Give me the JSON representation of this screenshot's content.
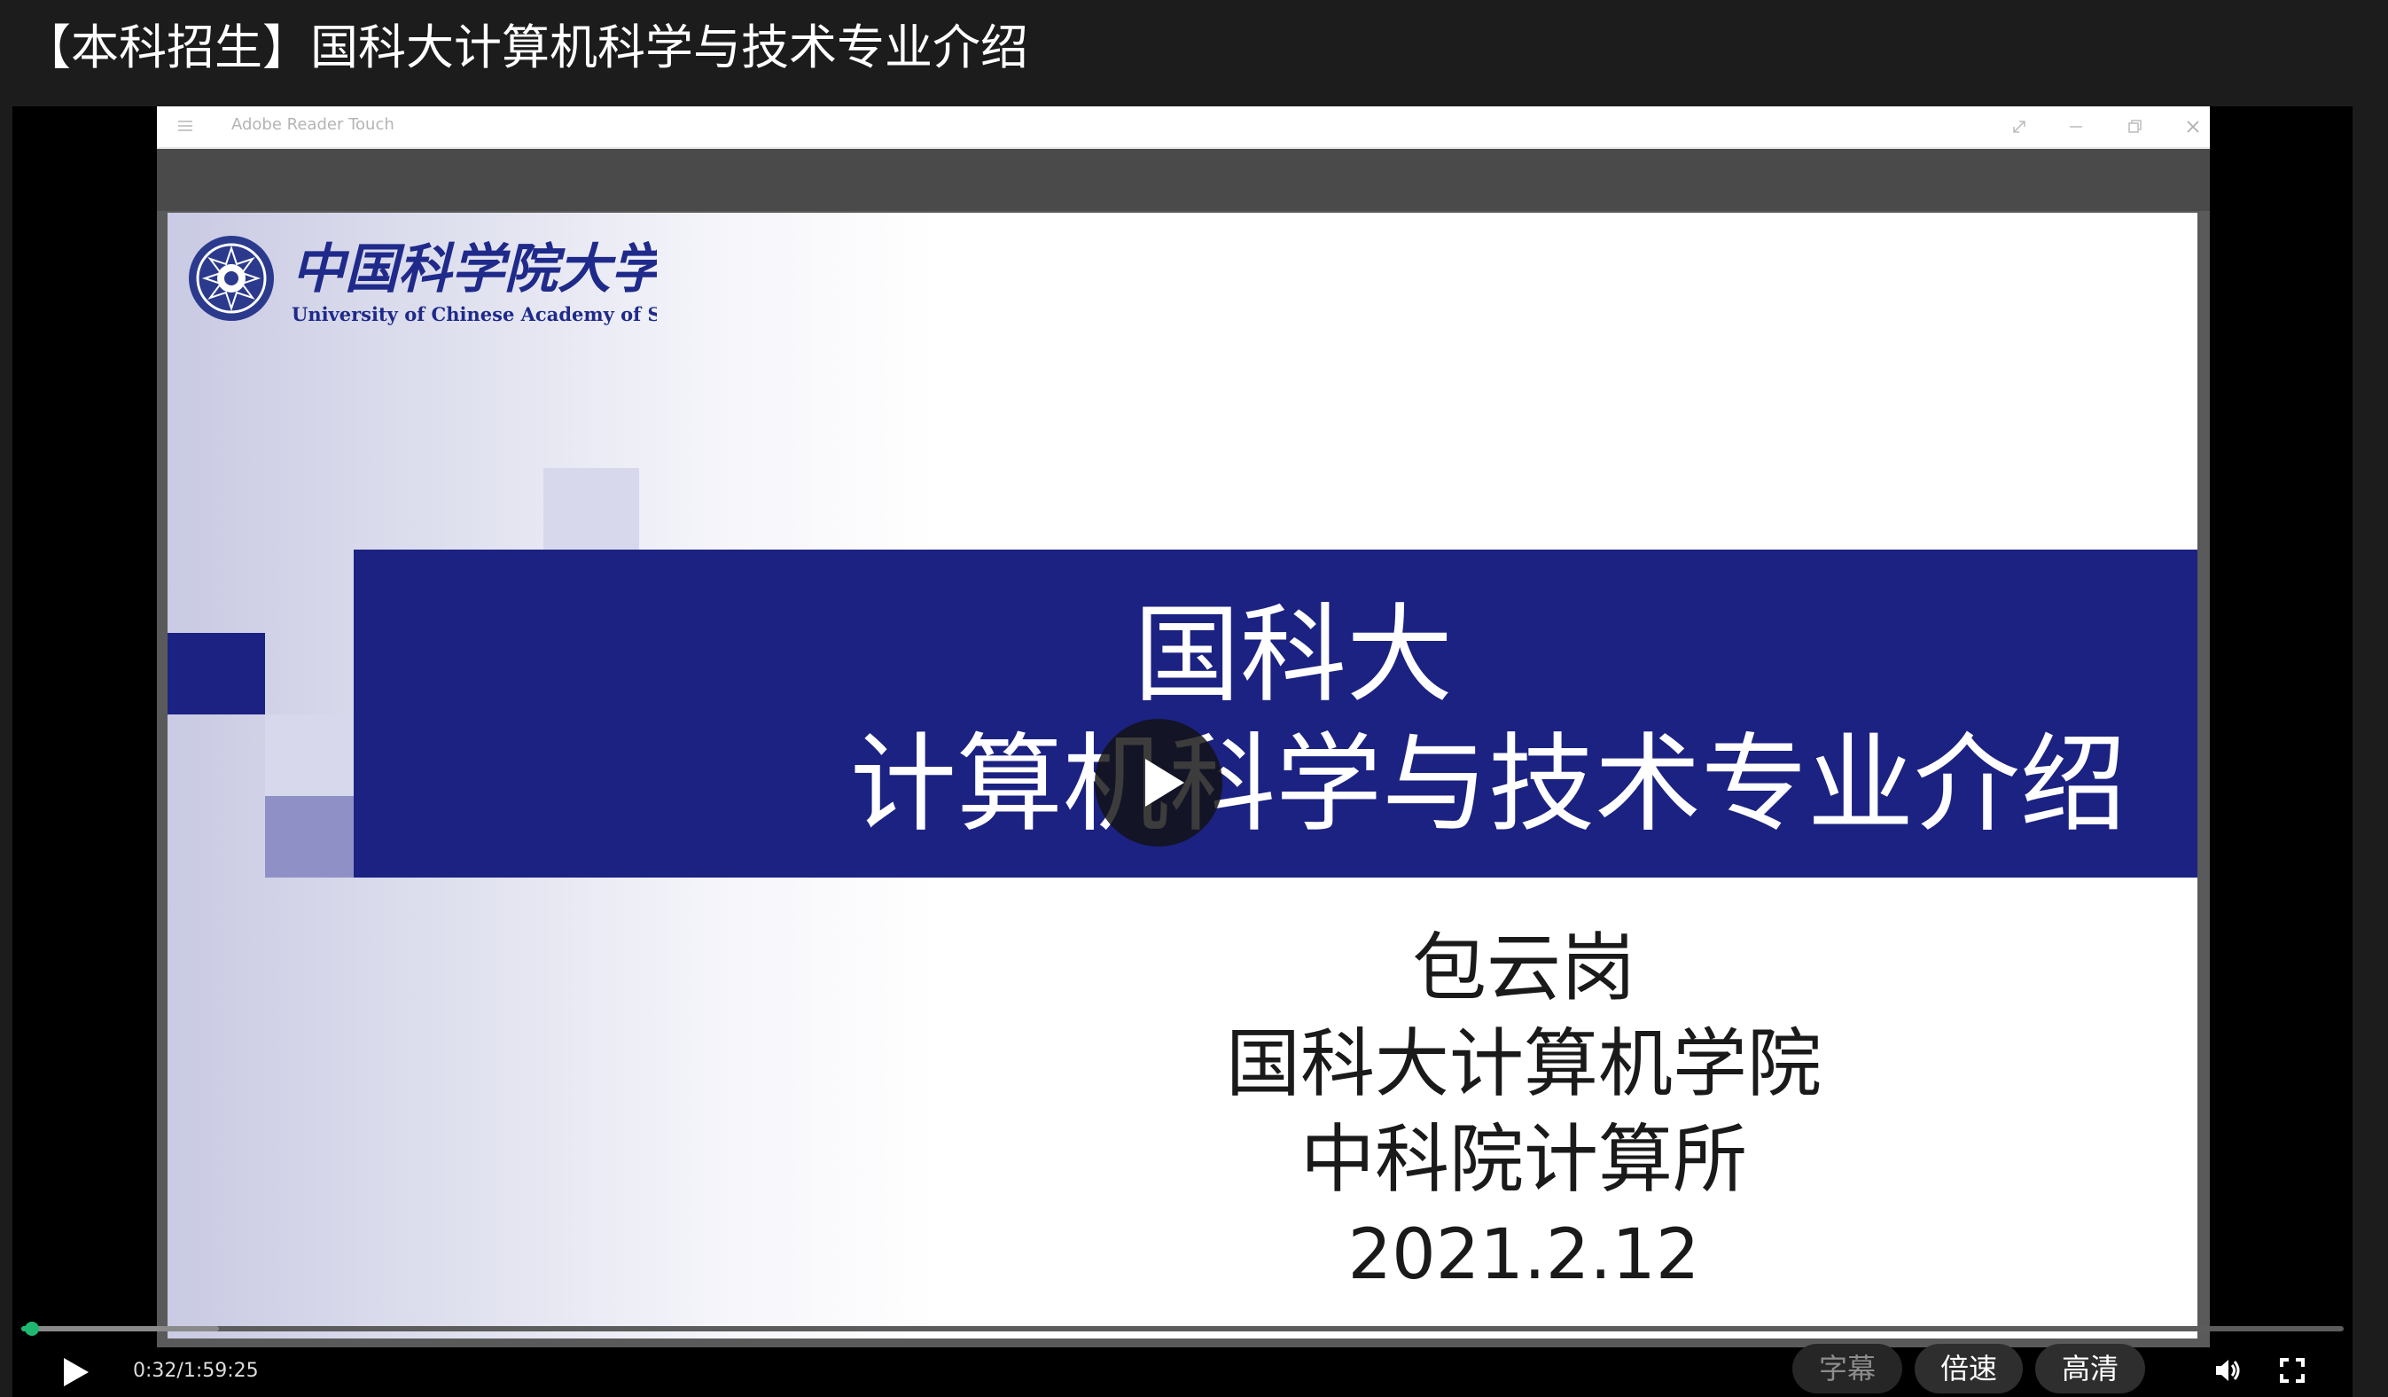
{
  "page": {
    "title": "【本科招生】国科大计算机科学与技术专业介绍"
  },
  "reader_window": {
    "title": "Adobe Reader Touch",
    "icons": [
      "menu-icon",
      "fullscreen-icon",
      "minimize-icon",
      "restore-icon",
      "close-icon"
    ]
  },
  "slide": {
    "logo_text_cn": "中国科学院大学",
    "logo_text_en": "University of Chinese Academy of Sciences",
    "title_line1": "国科大",
    "title_line2": "计算机科学与技术专业介绍",
    "presenter": "包云岗",
    "affiliation1": "国科大计算机学院",
    "affiliation2": "中科院计算所",
    "date": "2021.2.12",
    "colors": {
      "band": "#1c2282",
      "squares_dark": "#8f91c6",
      "squares_light": "#c3c4e0"
    }
  },
  "player": {
    "time": "0:32/1:59:25",
    "progress_fraction": 0.0045,
    "buffered_fraction": 0.085,
    "subtitle_label": "字幕",
    "speed_label": "倍速",
    "quality_label": "高清",
    "icons": [
      "play-icon",
      "volume-icon",
      "fullscreen-icon",
      "center-play-icon"
    ],
    "accent_color": "#1fb870"
  }
}
